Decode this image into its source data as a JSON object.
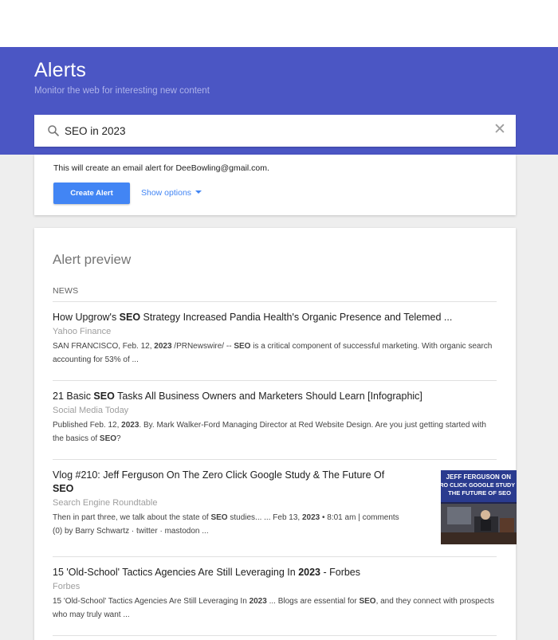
{
  "header": {
    "title": "Alerts",
    "subtitle": "Monitor the web for interesting new content"
  },
  "search": {
    "value": "SEO in 2023",
    "icon": "search-icon",
    "clear_icon": "close-icon"
  },
  "create": {
    "message": "This will create an email alert for DeeBowling@gmail.com.",
    "button_label": "Create Alert",
    "options_label": "Show options"
  },
  "preview": {
    "title": "Alert preview",
    "section": "NEWS",
    "articles": [
      {
        "title_html": "How Upgrow's <b>SEO</b> Strategy Increased Pandia Health's Organic Presence and Telemed ...",
        "source": "Yahoo Finance",
        "snippet_html": "SAN FRANCISCO, Feb. 12, <b>2023</b> /PRNewswire/ -- <b>SEO</b> is a critical component of successful marketing. With organic search accounting for 53% of ..."
      },
      {
        "title_html": "21 Basic <b>SEO</b> Tasks All Business Owners and Marketers Should Learn [Infographic]",
        "source": "Social Media Today",
        "snippet_html": "Published Feb. 12, <b>2023</b>. By. Mark Walker-Ford Managing Director at Red Website Design. Are you just getting started with the basics of <b>SEO</b>?"
      },
      {
        "title_html": "Vlog #210: Jeff Ferguson On The Zero Click Google Study &amp; The Future Of <b>SEO</b>",
        "source": "Search Engine Roundtable",
        "snippet_html": "Then in part three, we talk about the state of <b>SEO</b> studies... ... Feb 13, <b>2023</b> • 8:01 am | comments (0) by Barry Schwartz · twitter · mastodon ...",
        "thumb_text": [
          "JEFF FERGUSON ON",
          "ZERO CLICK GOOGLE STUDY",
          "THE FUTURE OF SEO"
        ]
      },
      {
        "title_html": "15 'Old-School' Tactics Agencies Are Still Leveraging In <b>2023</b> - Forbes",
        "source": "Forbes",
        "snippet_html": "15 'Old-School' Tactics Agencies Are Still Leveraging In <b>2023</b> ... Blogs are essential for <b>SEO</b>, and they connect with prospects who may truly want ..."
      }
    ]
  },
  "colors": {
    "header_bg": "#4b56c4",
    "accent": "#4285f4",
    "page_bg": "#eeeeee"
  }
}
